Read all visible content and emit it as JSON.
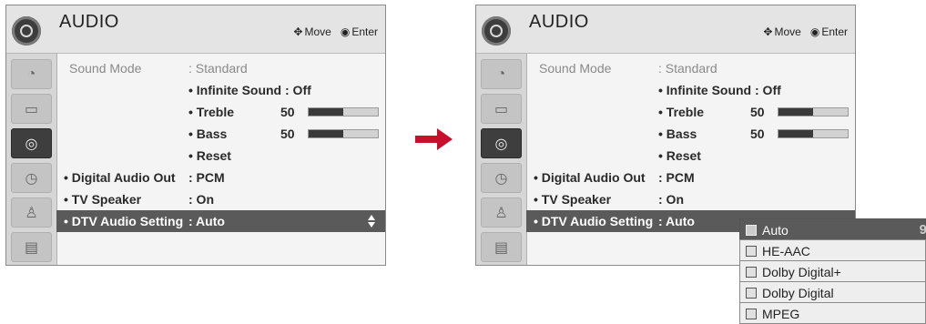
{
  "colors": {
    "arrow": "#c8102e",
    "highlight": "#5a5a5a",
    "panel_bg": "#f4f4f4"
  },
  "panels": [
    {
      "title": "AUDIO",
      "hint_move_icon": "move-cross-icon",
      "hint_move": "Move",
      "hint_enter_icon": "enter-dot-icon",
      "hint_enter": "Enter",
      "sidebar_icons": [
        "picture-icon",
        "screen-icon",
        "audio-icon",
        "clock-icon",
        "lock-icon",
        "option-icon"
      ],
      "sidebar_selected_index": 2,
      "rows": [
        {
          "label": "Sound Mode",
          "value": ": Standard",
          "dimmed": true
        },
        {
          "label": "",
          "value": "• Infinite Sound : Off"
        },
        {
          "label": "",
          "value": "• Treble",
          "number": "50",
          "level": 0.5
        },
        {
          "label": "",
          "value": "• Bass",
          "number": "50",
          "level": 0.5
        },
        {
          "label": "",
          "value": "• Reset"
        },
        {
          "label": "• Digital Audio Out",
          "value": ": PCM"
        },
        {
          "label": "• TV Speaker",
          "value": ": On"
        },
        {
          "label": "• DTV Audio Setting",
          "value": ": Auto",
          "selected": true
        }
      ]
    },
    {
      "title": "AUDIO",
      "hint_move_icon": "move-cross-icon",
      "hint_move": "Move",
      "hint_enter_icon": "enter-dot-icon",
      "hint_enter": "Enter",
      "sidebar_icons": [
        "picture-icon",
        "screen-icon",
        "audio-icon",
        "clock-icon",
        "lock-icon",
        "option-icon"
      ],
      "sidebar_selected_index": 2,
      "rows": [
        {
          "label": "Sound Mode",
          "value": ": Standard",
          "dimmed": true
        },
        {
          "label": "",
          "value": "• Infinite Sound : Off"
        },
        {
          "label": "",
          "value": "• Treble",
          "number": "50",
          "level": 0.5
        },
        {
          "label": "",
          "value": "• Bass",
          "number": "50",
          "level": 0.5
        },
        {
          "label": "",
          "value": "• Reset"
        },
        {
          "label": "• Digital Audio Out",
          "value": ": PCM"
        },
        {
          "label": "• TV Speaker",
          "value": ": On"
        },
        {
          "label": "• DTV Audio Setting",
          "value": ": Auto",
          "selected": true
        }
      ]
    }
  ],
  "dropdown": {
    "options": [
      "Auto",
      "HE-AAC",
      "Dolby Digital+",
      "Dolby Digital",
      "MPEG"
    ],
    "selected_index": 0
  }
}
